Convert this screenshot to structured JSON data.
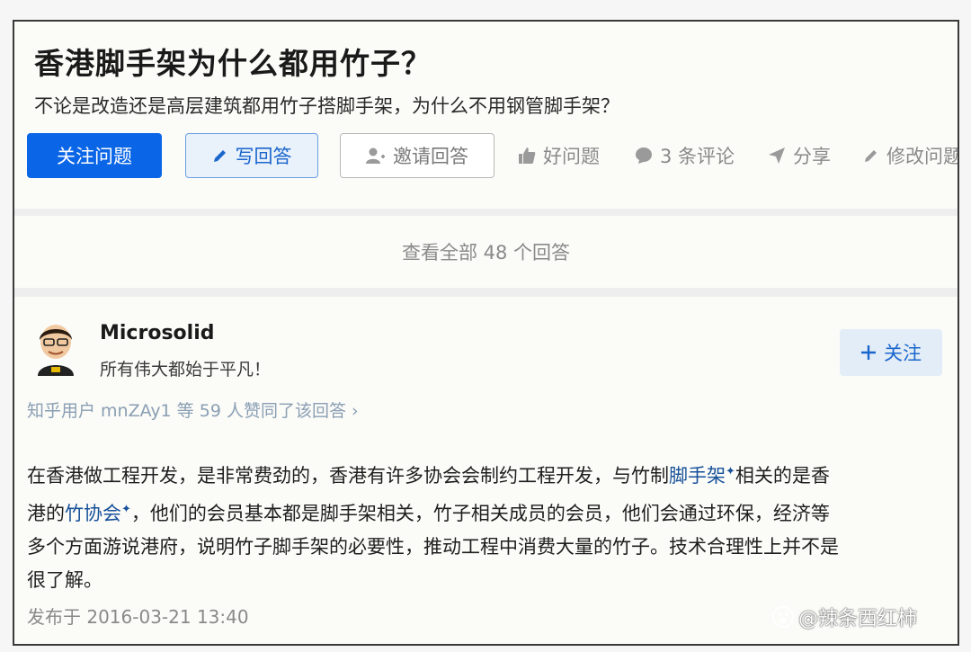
{
  "question": {
    "title": "香港脚手架为什么都用竹子？",
    "detail": "不论是改造还是高层建筑都用竹子搭脚手架，为什么不用钢管脚手架？",
    "buttons": {
      "follow": "关注问题",
      "write": "写回答",
      "invite": "邀请回答"
    },
    "actions": {
      "good": "好问题",
      "comments": "3 条评论",
      "share": "分享",
      "edit": "修改问题"
    }
  },
  "view_all": "查看全部 48 个回答",
  "answer": {
    "author": "Microsolid",
    "bio": "所有伟大都始于平凡！",
    "follow": "+ 关注",
    "follow_label": "关注",
    "likes": "知乎用户 mnZAy1 等 59 人赞同了该回答 ›",
    "body": {
      "line1_a": "在香港做工程开发，是非常费劲的，香港有许多协会会制约工程开发，与竹制",
      "link1": "脚手架",
      "line1_b": "相关的是香",
      "line2_a": "港的",
      "link2": "竹协会",
      "line2_b": "，他们的会员基本都是脚手架相关，竹子相关成员的会员，他们会通过环保，经济等",
      "line3": "多个方面游说港府，说明竹子脚手架的必要性，推动工程中消费大量的竹子。技术合理性上并不是",
      "line4": "很了解。"
    },
    "published": "发布于 2016-03-21 13:40"
  },
  "watermark": "@辣条西红柿",
  "colors": {
    "primary": "#0a66e6",
    "link": "#175199",
    "muted": "#8a8a8a"
  }
}
